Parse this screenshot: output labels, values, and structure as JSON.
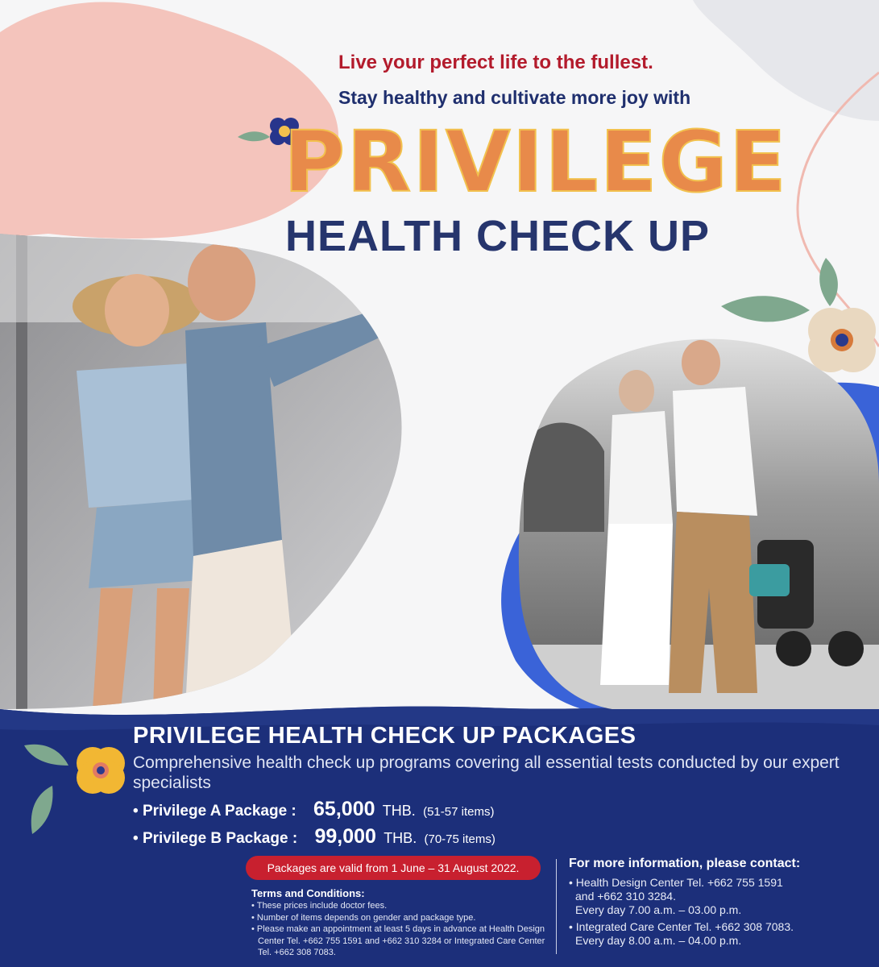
{
  "hero": {
    "tagline1": "Live your perfect life to the fullest.",
    "tagline2": "Stay healthy and cultivate more joy with",
    "brand": "PRIVILEGE",
    "subtitle": "HEALTH CHECK UP"
  },
  "packages": {
    "title": "PRIVILEGE HEALTH CHECK UP PACKAGES",
    "description": "Comprehensive health check up programs covering all essential tests conducted by our expert specialists",
    "items": [
      {
        "label": "Privilege A Package :",
        "price": "65,000",
        "currency": "THB.",
        "items": "(51-57 items)"
      },
      {
        "label": "Privilege B Package :",
        "price": "99,000",
        "currency": "THB.",
        "items": "(70-75 items)"
      }
    ],
    "validity": "Packages are valid from 1 June – 31 August 2022."
  },
  "terms": {
    "title": "Terms and Conditions:",
    "lines": [
      "These prices include doctor fees.",
      "Number of items depends on gender and package type.",
      "Please make an appointment at least 5 days in advance at Health Design Center Tel. +662 755 1591 and  +662 310 3284 or Integrated Care Center Tel. +662 308 7083."
    ]
  },
  "contact": {
    "title": "For more information, please contact:",
    "entries": [
      {
        "line1": "Health Design Center Tel. +662 755 1591",
        "line2": "and +662 310 3284.",
        "line3": "Every day 7.00 a.m. – 03.00 p.m."
      },
      {
        "line1": "Integrated Care Center Tel. +662 308 7083.",
        "line2": "Every day 8.00 a.m. – 04.00 p.m."
      }
    ]
  },
  "colors": {
    "accent_red": "#b31b2c",
    "navy": "#1f2f6e",
    "panel_navy": "#1c2f7a",
    "royal_blue": "#3a63d8",
    "blush_pink": "#f4c4bc",
    "validity_red": "#c8202f"
  }
}
